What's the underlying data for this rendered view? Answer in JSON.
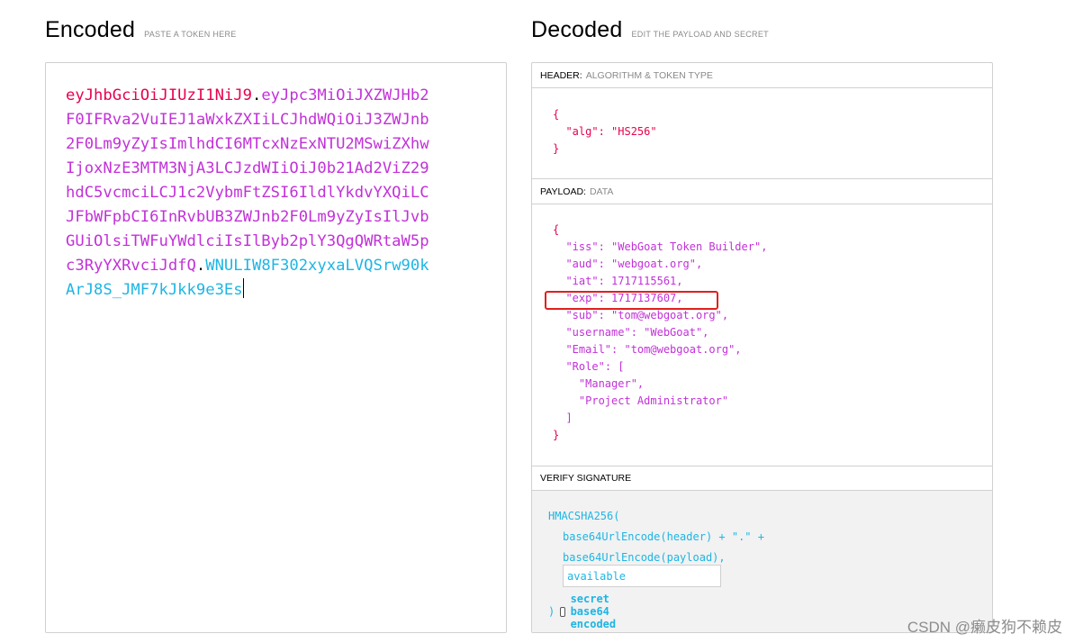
{
  "encoded": {
    "title": "Encoded",
    "subtitle": "PASTE A TOKEN HERE",
    "lines": [
      [
        {
          "t": "eyJhbGciOiJIUzI1NiJ9",
          "c": "c-header"
        },
        {
          "t": ".",
          "c": "c-dot"
        },
        {
          "t": "eyJpc3MiOiJXZWJHb2",
          "c": "c-payload"
        }
      ],
      [
        {
          "t": "F0IFRva2VuIEJ1aWxkZXIiLCJhdWQiOiJ3ZWJnb",
          "c": "c-payload"
        }
      ],
      [
        {
          "t": "2F0Lm9yZyIsImlhdCI6MTcxNzExNTU2MSwiZXhw",
          "c": "c-payload"
        }
      ],
      [
        {
          "t": "IjoxNzE3MTM3NjA3LCJzdWIiOiJ0b21Ad2ViZ29",
          "c": "c-payload"
        }
      ],
      [
        {
          "t": "hdC5vcmciLCJ1c2VybmFtZSI6IldlYkdvYXQiLC",
          "c": "c-payload"
        }
      ],
      [
        {
          "t": "JFbWFpbCI6InRvbUB3ZWJnb2F0Lm9yZyIsIlJvb",
          "c": "c-payload"
        }
      ],
      [
        {
          "t": "GUiOlsiTWFuYWdlciIsIlByb2plY3QgQWRtaW5p",
          "c": "c-payload"
        }
      ],
      [
        {
          "t": "c3RyYXRvciJdfQ",
          "c": "c-payload"
        },
        {
          "t": ".",
          "c": "c-dot"
        },
        {
          "t": "WNULIW8F302xyxaLVQSrw90k",
          "c": "c-sig"
        }
      ],
      [
        {
          "t": "ArJ8S_JMF7kJkk9e3Es",
          "c": "c-sig"
        }
      ]
    ]
  },
  "decoded": {
    "title": "Decoded",
    "subtitle": "EDIT THE PAYLOAD AND SECRET",
    "header_section": {
      "label": "HEADER:",
      "sub": "ALGORITHM & TOKEN TYPE"
    },
    "header_json": [
      {
        "indent": 0,
        "text": "{"
      },
      {
        "indent": 1,
        "key": "\"alg\"",
        "val": "\"HS256\""
      },
      {
        "indent": 0,
        "text": "}"
      }
    ],
    "payload_section": {
      "label": "PAYLOAD:",
      "sub": "DATA"
    },
    "payload_json": [
      {
        "indent": 0,
        "text": "{"
      },
      {
        "indent": 1,
        "key": "\"iss\"",
        "val": "\"WebGoat Token Builder\","
      },
      {
        "indent": 1,
        "key": "\"aud\"",
        "val": "\"webgoat.org\","
      },
      {
        "indent": 1,
        "key": "\"iat\"",
        "val": "1717115561,"
      },
      {
        "indent": 1,
        "key": "\"exp\"",
        "val": "1717137607,"
      },
      {
        "indent": 1,
        "key": "\"sub\"",
        "val": "\"tom@webgoat.org\","
      },
      {
        "indent": 1,
        "key": "\"username\"",
        "val": "\"WebGoat\","
      },
      {
        "indent": 1,
        "key": "\"Email\"",
        "val": "\"tom@webgoat.org\","
      },
      {
        "indent": 1,
        "key": "\"Role\"",
        "val": "["
      },
      {
        "indent": 2,
        "text": "\"Manager\","
      },
      {
        "indent": 2,
        "text": "\"Project Administrator\""
      },
      {
        "indent": 1,
        "text": "]"
      },
      {
        "indent": 0,
        "text": "}"
      }
    ],
    "verify_section": {
      "label": "VERIFY SIGNATURE"
    },
    "verify": {
      "fn": "HMACSHA256(",
      "line1": "base64UrlEncode(header) + \".\" +",
      "line2": "base64UrlEncode(payload),",
      "secret_value": "available",
      "close": ")",
      "checkbox_label": "secret base64 encoded"
    }
  },
  "watermark": "CSDN @癞皮狗不赖皮",
  "colors": {
    "header": "#e8004c",
    "payload": "#c231d8",
    "signature": "#1eb5e3",
    "highlight": "#e0201e"
  }
}
